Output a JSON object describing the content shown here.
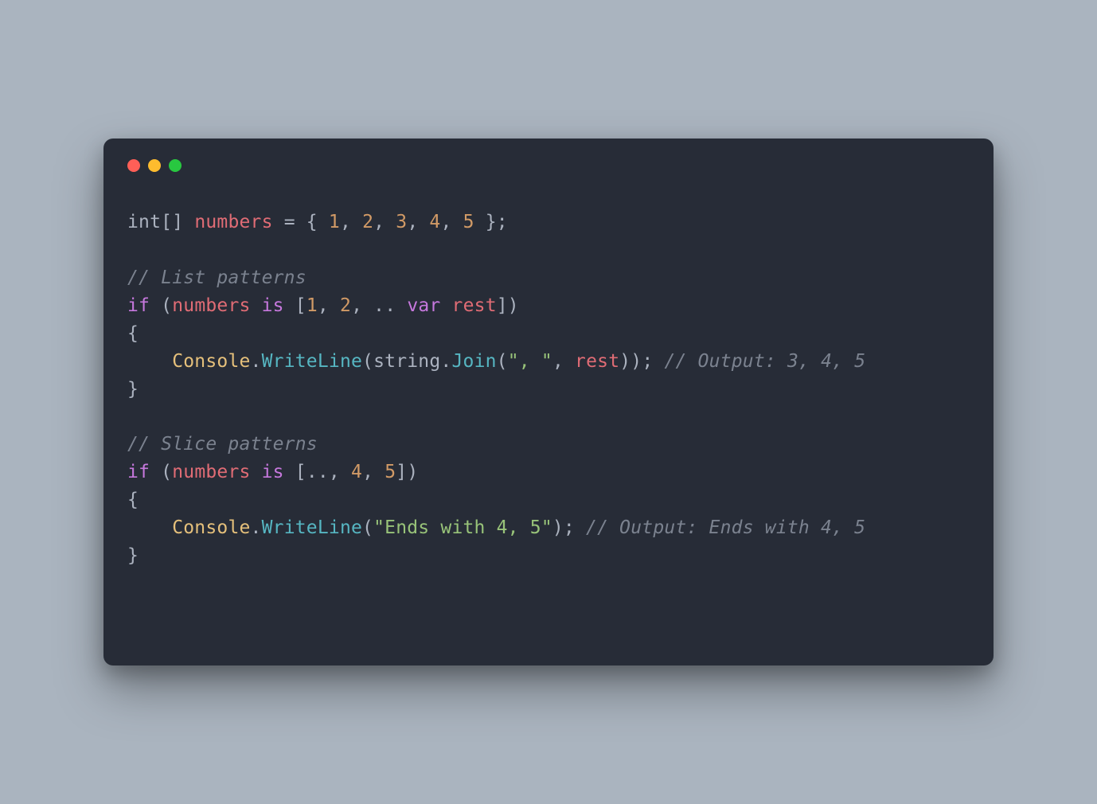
{
  "window": {
    "traffic_lights": [
      "close",
      "minimize",
      "zoom"
    ]
  },
  "code": {
    "tokens": [
      [
        {
          "t": "int",
          "c": "tok-type"
        },
        {
          "t": "[] ",
          "c": "tok-punc"
        },
        {
          "t": "numbers",
          "c": "tok-ident"
        },
        {
          "t": " = { ",
          "c": "tok-punc"
        },
        {
          "t": "1",
          "c": "tok-num"
        },
        {
          "t": ", ",
          "c": "tok-punc"
        },
        {
          "t": "2",
          "c": "tok-num"
        },
        {
          "t": ", ",
          "c": "tok-punc"
        },
        {
          "t": "3",
          "c": "tok-num"
        },
        {
          "t": ", ",
          "c": "tok-punc"
        },
        {
          "t": "4",
          "c": "tok-num"
        },
        {
          "t": ", ",
          "c": "tok-punc"
        },
        {
          "t": "5",
          "c": "tok-num"
        },
        {
          "t": " };",
          "c": "tok-punc"
        }
      ],
      [],
      [
        {
          "t": "// List patterns",
          "c": "tok-comment"
        }
      ],
      [
        {
          "t": "if",
          "c": "tok-kw"
        },
        {
          "t": " (",
          "c": "tok-punc"
        },
        {
          "t": "numbers",
          "c": "tok-ident"
        },
        {
          "t": " ",
          "c": "tok-punc"
        },
        {
          "t": "is",
          "c": "tok-kw"
        },
        {
          "t": " [",
          "c": "tok-punc"
        },
        {
          "t": "1",
          "c": "tok-num"
        },
        {
          "t": ", ",
          "c": "tok-punc"
        },
        {
          "t": "2",
          "c": "tok-num"
        },
        {
          "t": ", .. ",
          "c": "tok-punc"
        },
        {
          "t": "var",
          "c": "tok-kw"
        },
        {
          "t": " ",
          "c": "tok-punc"
        },
        {
          "t": "rest",
          "c": "tok-ident"
        },
        {
          "t": "])",
          "c": "tok-punc"
        }
      ],
      [
        {
          "t": "{",
          "c": "tok-punc"
        }
      ],
      [
        {
          "t": "    ",
          "c": "tok-punc"
        },
        {
          "t": "Console",
          "c": "tok-class"
        },
        {
          "t": ".",
          "c": "tok-punc"
        },
        {
          "t": "WriteLine",
          "c": "tok-func"
        },
        {
          "t": "(",
          "c": "tok-punc"
        },
        {
          "t": "string",
          "c": "tok-type"
        },
        {
          "t": ".",
          "c": "tok-punc"
        },
        {
          "t": "Join",
          "c": "tok-func"
        },
        {
          "t": "(",
          "c": "tok-punc"
        },
        {
          "t": "\", \"",
          "c": "tok-str"
        },
        {
          "t": ", ",
          "c": "tok-punc"
        },
        {
          "t": "rest",
          "c": "tok-ident"
        },
        {
          "t": ")); ",
          "c": "tok-punc"
        },
        {
          "t": "// Output: 3, 4, 5",
          "c": "tok-comment"
        }
      ],
      [
        {
          "t": "}",
          "c": "tok-punc"
        }
      ],
      [],
      [
        {
          "t": "// Slice patterns",
          "c": "tok-comment"
        }
      ],
      [
        {
          "t": "if",
          "c": "tok-kw"
        },
        {
          "t": " (",
          "c": "tok-punc"
        },
        {
          "t": "numbers",
          "c": "tok-ident"
        },
        {
          "t": " ",
          "c": "tok-punc"
        },
        {
          "t": "is",
          "c": "tok-kw"
        },
        {
          "t": " [.., ",
          "c": "tok-punc"
        },
        {
          "t": "4",
          "c": "tok-num"
        },
        {
          "t": ", ",
          "c": "tok-punc"
        },
        {
          "t": "5",
          "c": "tok-num"
        },
        {
          "t": "])",
          "c": "tok-punc"
        }
      ],
      [
        {
          "t": "{",
          "c": "tok-punc"
        }
      ],
      [
        {
          "t": "    ",
          "c": "tok-punc"
        },
        {
          "t": "Console",
          "c": "tok-class"
        },
        {
          "t": ".",
          "c": "tok-punc"
        },
        {
          "t": "WriteLine",
          "c": "tok-func"
        },
        {
          "t": "(",
          "c": "tok-punc"
        },
        {
          "t": "\"Ends with 4, 5\"",
          "c": "tok-str"
        },
        {
          "t": "); ",
          "c": "tok-punc"
        },
        {
          "t": "// Output: Ends with 4, 5",
          "c": "tok-comment"
        }
      ],
      [
        {
          "t": "}",
          "c": "tok-punc"
        }
      ]
    ]
  }
}
